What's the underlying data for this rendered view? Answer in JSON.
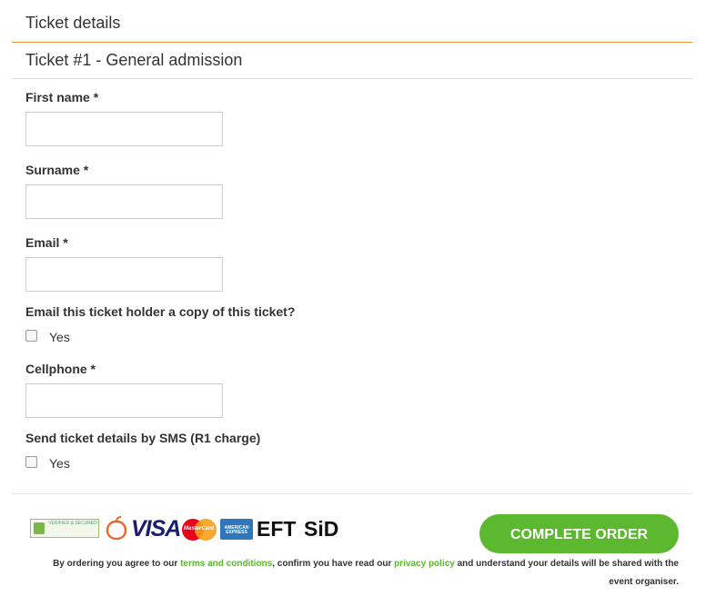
{
  "section": {
    "title": "Ticket details"
  },
  "ticket": {
    "title": "Ticket #1 - General admission"
  },
  "form": {
    "first_name": {
      "label": "First name *",
      "value": ""
    },
    "surname": {
      "label": "Surname *",
      "value": ""
    },
    "email": {
      "label": "Email *",
      "value": ""
    },
    "email_copy": {
      "label": "Email this ticket holder a copy of this ticket?",
      "option": "Yes",
      "checked": false
    },
    "cellphone": {
      "label": "Cellphone *",
      "value": ""
    },
    "sms": {
      "label": "Send ticket details by SMS (R1 charge)",
      "option": "Yes",
      "checked": false
    }
  },
  "payment_logos": {
    "secure_badge": "VERIFIED & SECURED",
    "visa": "VISA",
    "mastercard": "MasterCard",
    "amex": "AMERICAN EXPRESS",
    "eft": "EFT",
    "sid": "SiD"
  },
  "footer": {
    "button_label": "COMPLETE ORDER",
    "terms_prefix": "By ordering you agree to our ",
    "terms_link": "terms and conditions",
    "terms_mid": ", confirm you have read our ",
    "privacy_link": "privacy policy",
    "terms_suffix": " and understand your details will be shared with the event organiser."
  },
  "colors": {
    "accent": "#e8962e",
    "button": "#5cb82e",
    "link": "#5cb82e"
  }
}
